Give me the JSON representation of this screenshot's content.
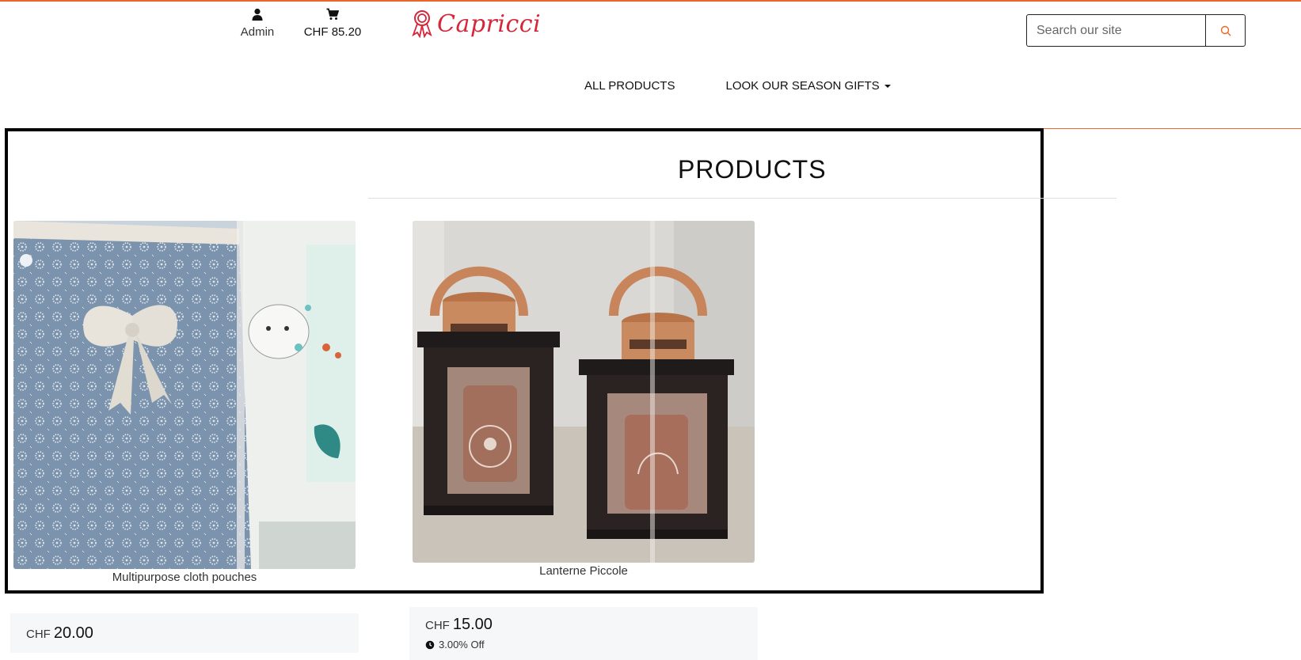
{
  "header": {
    "account_label": "Admin",
    "cart_label": "CHF 85.20",
    "logo_text": "Capricci",
    "accent_color": "#e8672a",
    "logo_color": "#d6263a"
  },
  "search": {
    "placeholder": "Search our site",
    "icon": "search-icon"
  },
  "nav": {
    "items": [
      {
        "label": "ALL PRODUCTS"
      },
      {
        "label": "LOOK OUR SEASON GIFTS"
      }
    ]
  },
  "main": {
    "title": "PRODUCTS",
    "products": [
      {
        "name": "Multipurpose cloth pouches",
        "currency": "CHF",
        "price": "20.00",
        "discount": ""
      },
      {
        "name": "Lanterne Piccole",
        "currency": "CHF",
        "price": "15.00",
        "discount": "3.00% Off"
      }
    ]
  }
}
